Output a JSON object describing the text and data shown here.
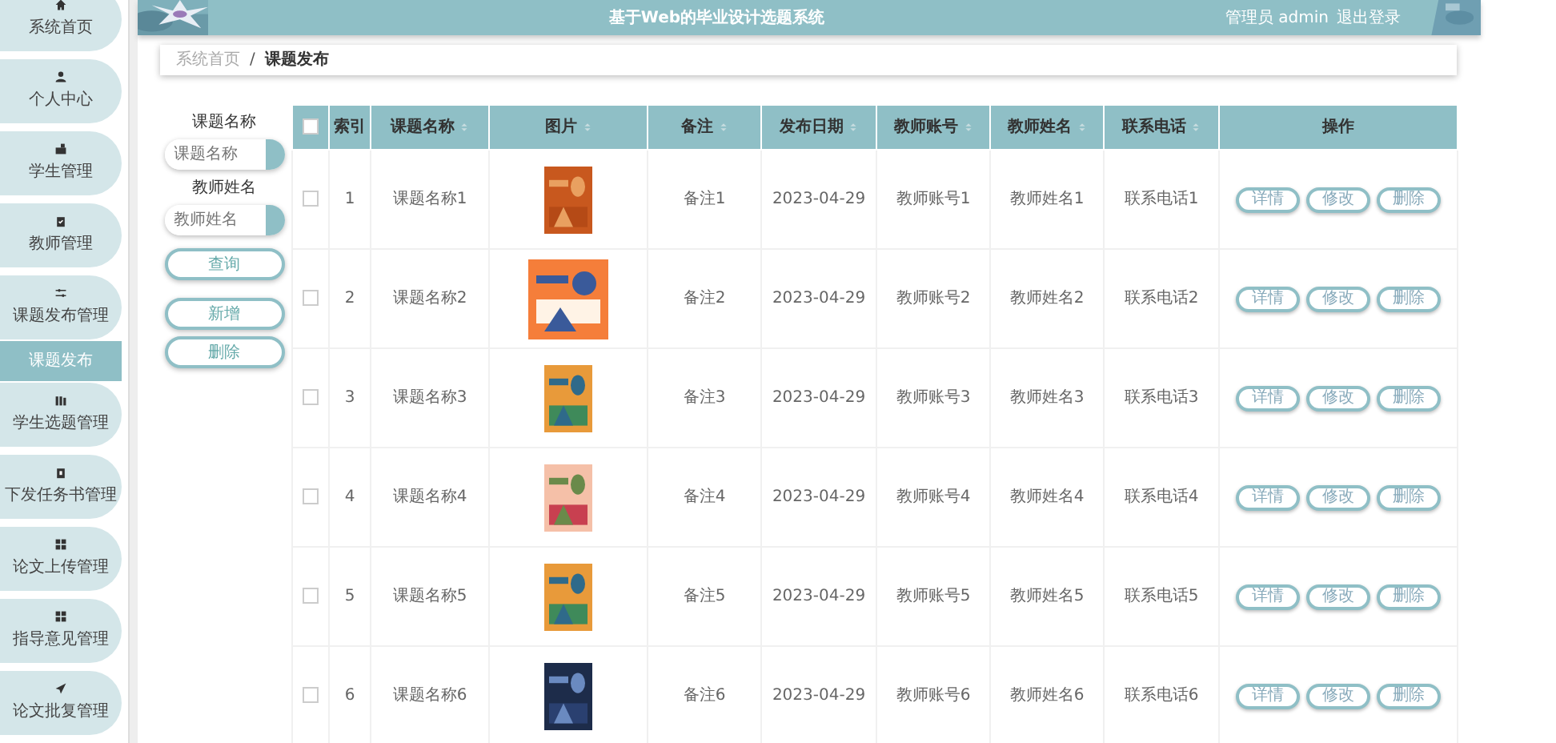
{
  "header": {
    "title": "基于Web的毕业设计选题系统",
    "user": "管理员 admin",
    "logout": "退出登录"
  },
  "sidebar": {
    "items": [
      {
        "label": "系统首页",
        "kind": "menu",
        "selected": false
      },
      {
        "label": "个人中心",
        "kind": "menu",
        "selected": false
      },
      {
        "label": "学生管理",
        "kind": "menu",
        "selected": false
      },
      {
        "label": "教师管理",
        "kind": "menu",
        "selected": false
      },
      {
        "label": "课题发布管理",
        "kind": "menu",
        "selected": false
      },
      {
        "label": "课题发布",
        "kind": "submenu",
        "selected": true
      },
      {
        "label": "学生选题管理",
        "kind": "menu",
        "selected": false
      },
      {
        "label": "下发任务书管理",
        "kind": "menu",
        "selected": false
      },
      {
        "label": "论文上传管理",
        "kind": "menu",
        "selected": false
      },
      {
        "label": "指导意见管理",
        "kind": "menu",
        "selected": false
      },
      {
        "label": "论文批复管理",
        "kind": "menu",
        "selected": false
      }
    ]
  },
  "breadcrumb": {
    "items": [
      "系统首页",
      "课题发布"
    ],
    "separator": "/"
  },
  "search": {
    "fields": [
      {
        "label": "课题名称",
        "placeholder": "课题名称"
      },
      {
        "label": "教师姓名",
        "placeholder": "教师姓名"
      }
    ],
    "buttons": [
      "查询",
      "新增",
      "删除"
    ]
  },
  "table": {
    "select_all": {
      "checked": false
    },
    "columns": [
      {
        "label": "索引",
        "sortable": false
      },
      {
        "label": "课题名称",
        "sortable": true
      },
      {
        "label": "图片",
        "sortable": true
      },
      {
        "label": "备注",
        "sortable": true
      },
      {
        "label": "发布日期",
        "sortable": true
      },
      {
        "label": "教师账号",
        "sortable": true
      },
      {
        "label": "教师姓名",
        "sortable": true
      },
      {
        "label": "联系电话",
        "sortable": true
      },
      {
        "label": "操作",
        "sortable": false
      }
    ],
    "rows": [
      {
        "checked": false,
        "cells": [
          "1",
          "课题名称1",
          "",
          "备注1",
          "2023-04-29",
          "教师账号1",
          "教师姓名1",
          "联系电话1"
        ],
        "picture": {
          "kind": "picture"
        },
        "actions": [
          "详情",
          "修改",
          "删除"
        ]
      },
      {
        "checked": false,
        "cells": [
          "2",
          "课题名称2",
          "",
          "备注2",
          "2023-04-29",
          "教师账号2",
          "教师姓名2",
          "联系电话2"
        ],
        "picture": {
          "kind": "picture"
        },
        "actions": [
          "详情",
          "修改",
          "删除"
        ]
      },
      {
        "checked": false,
        "cells": [
          "3",
          "课题名称3",
          "",
          "备注3",
          "2023-04-29",
          "教师账号3",
          "教师姓名3",
          "联系电话3"
        ],
        "picture": {
          "kind": "picture"
        },
        "actions": [
          "详情",
          "修改",
          "删除"
        ]
      },
      {
        "checked": false,
        "cells": [
          "4",
          "课题名称4",
          "",
          "备注4",
          "2023-04-29",
          "教师账号4",
          "教师姓名4",
          "联系电话4"
        ],
        "picture": {
          "kind": "picture"
        },
        "actions": [
          "详情",
          "修改",
          "删除"
        ]
      },
      {
        "checked": false,
        "cells": [
          "5",
          "课题名称5",
          "",
          "备注5",
          "2023-04-29",
          "教师账号5",
          "教师姓名5",
          "联系电话5"
        ],
        "picture": {
          "kind": "picture"
        },
        "actions": [
          "详情",
          "修改",
          "删除"
        ]
      },
      {
        "checked": false,
        "cells": [
          "6",
          "课题名称6",
          "",
          "备注6",
          "2023-04-29",
          "教师账号6",
          "教师姓名6",
          "联系电话6"
        ],
        "picture": {
          "kind": "picture"
        },
        "actions": [
          "详情",
          "修改",
          "删除"
        ]
      }
    ]
  }
}
